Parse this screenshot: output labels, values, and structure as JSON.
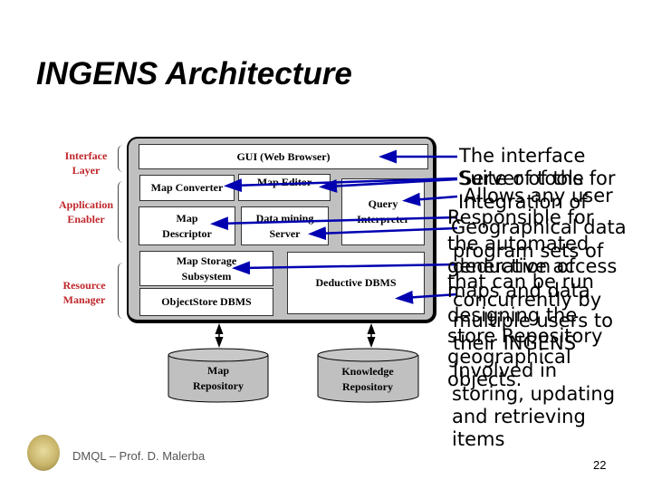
{
  "slide": {
    "title": "INGENS Architecture",
    "footer": "DMQL – Prof. D. Malerba",
    "page_number": "22"
  },
  "layers": {
    "interface": [
      "Interface",
      "Layer"
    ],
    "application": [
      "Application",
      "Enabler"
    ],
    "resource": [
      "Resource",
      "Manager"
    ]
  },
  "components": {
    "gui": "GUI (Web Browser)",
    "map_converter": "Map Converter",
    "map_editor": "Map Editor",
    "query_interpreter": [
      "Query",
      "Interpreter"
    ],
    "map_descriptor": [
      "Map",
      "Descriptor"
    ],
    "data_mining_server": [
      "Data mining",
      "Server"
    ],
    "map_storage": [
      "Map Storage",
      "Subsystem"
    ],
    "objectstore": "ObjectStore DBMS",
    "deductive": "Deductive DBMS",
    "map_repository": [
      "Map",
      "Repository"
    ],
    "knowledge_repository": [
      "Knowledge",
      "Repository"
    ]
  },
  "annotations": [
    "The interface",
    "Suite of tools for",
    "Server of the",
    "Allows any user",
    "Integration of",
    "Responsible for",
    "Geographical data",
    "the automated",
    "program sets of",
    "generation of",
    "deductive access",
    "that can be run",
    "maps and data",
    "concurrently by",
    "designing the",
    "multiple users to",
    "store Repository",
    "their INGENS",
    "geographical",
    "Involved in",
    "objects.",
    "storing, updating",
    "and retrieving",
    "items"
  ],
  "colors": {
    "layer_label": "#c0262b",
    "arrow": "#0000b0",
    "diagram_bg": "#c0c0c0"
  }
}
